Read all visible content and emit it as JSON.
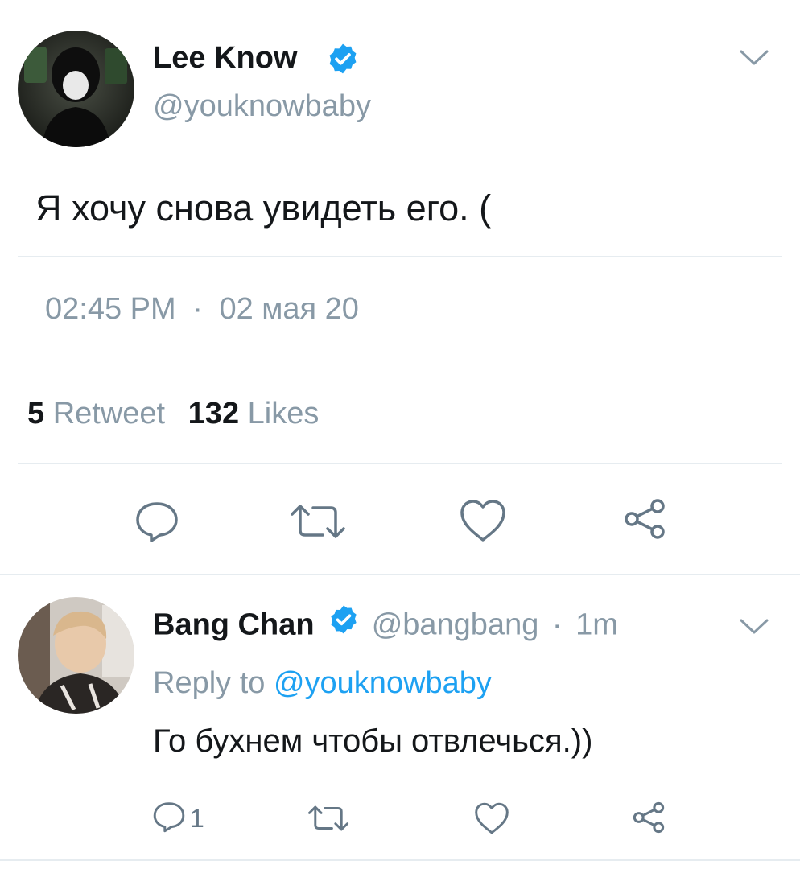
{
  "main_tweet": {
    "author_name": "Lee Know",
    "handle": "@youknowbaby",
    "text": "Я хочу снова увидеть его. (",
    "time": "02:45 PM",
    "separator": "·",
    "date": "02 мая 20",
    "retweets_count": "5",
    "retweets_label": "Retweet",
    "likes_count": "132",
    "likes_label": "Likes"
  },
  "reply": {
    "author_name": "Bang Chan",
    "handle": "@bangbang",
    "time_sep": "·",
    "time": "1m",
    "reply_prefix": "Reply to",
    "reply_handle": "@youknowbaby",
    "text": "Го бухнем чтобы отвлечься.))",
    "reply_count": "1"
  },
  "colors": {
    "accent": "#1da1f2",
    "muted": "#8899a6",
    "text": "#14171a",
    "divider": "#e6ecf0"
  },
  "icons": [
    "chevron-down-icon",
    "verified-badge-icon",
    "reply-icon",
    "retweet-icon",
    "like-icon",
    "share-icon"
  ]
}
